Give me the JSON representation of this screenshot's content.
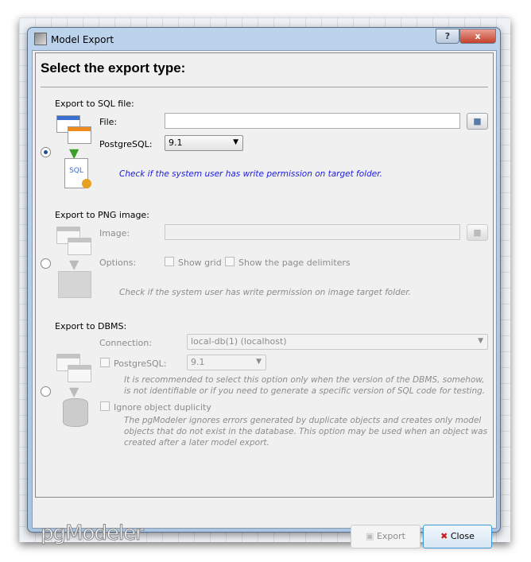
{
  "window": {
    "title": "Model Export",
    "help": "?",
    "close": "x"
  },
  "heading": "Select the export type:",
  "sql": {
    "section": "Export to SQL file:",
    "file_label": "File:",
    "file_value": "",
    "pg_label": "PostgreSQL:",
    "pg_value": "9.1",
    "hint": "Check if the system user has write permission on target folder.",
    "selected": true
  },
  "png": {
    "section": "Export to PNG image:",
    "image_label": "Image:",
    "image_value": "",
    "options_label": "Options:",
    "show_grid": "Show grid",
    "show_delims": "Show the page delimiters",
    "hint": "Check if the system user has write permission on image target folder.",
    "selected": false
  },
  "dbms": {
    "section": "Export to DBMS:",
    "connection_label": "Connection:",
    "connection_value": "local-db(1) (localhost)",
    "pg_label": "PostgreSQL:",
    "pg_value": "9.1",
    "pg_hint": "It is recommended to select this option only when the version of the DBMS, somehow, is not identifiable or if you need to generate a specific version of SQL code for testing.",
    "ignore_label": "Ignore object duplicity",
    "ignore_hint": "The pgModeler ignores errors generated by duplicate objects and creates only model objects that do not exist in the database. This option may be used when an object was created after a later model export.",
    "selected": false
  },
  "footer": {
    "logo": "pgModeler",
    "export": "Export",
    "close": "Close"
  },
  "colors": {
    "hint_blue": "#1a1ae6",
    "close_x": "#cc1a1a",
    "disabled": "#8c8c8c"
  }
}
